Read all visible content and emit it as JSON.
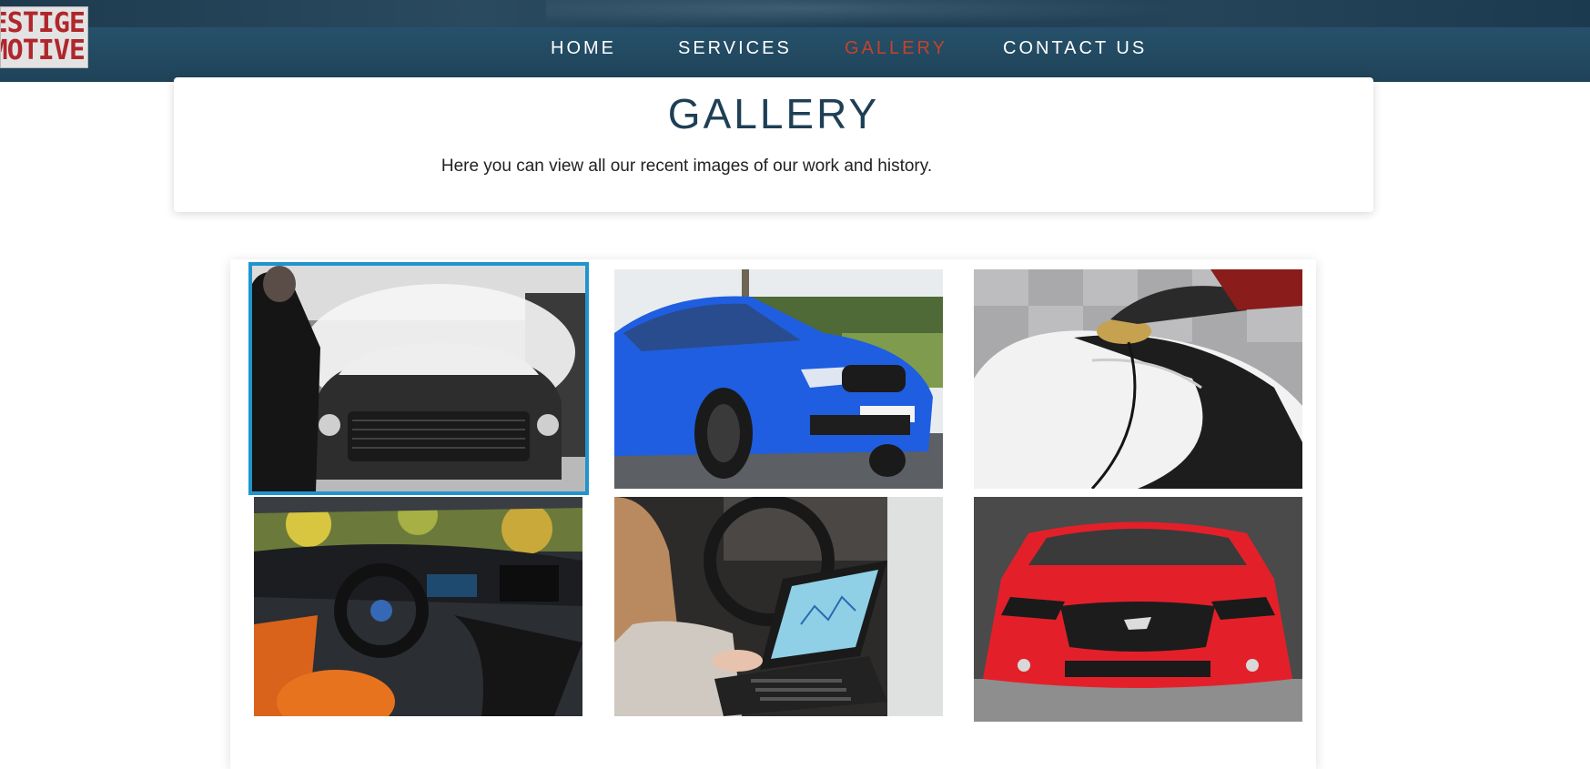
{
  "logo": {
    "line1": "ESTIGE",
    "line2": "MOTIVE"
  },
  "nav": {
    "items": [
      {
        "label": "HOME",
        "active": false
      },
      {
        "label": "SERVICES",
        "active": false
      },
      {
        "label": "GALLERY",
        "active": true
      },
      {
        "label": "CONTACT US",
        "active": false
      }
    ]
  },
  "intro": {
    "title": "GALLERY",
    "subtitle": "Here you can view all our recent images of our work and history."
  },
  "gallery": {
    "selected_index": 0,
    "colors": {
      "selection_outline": "#2194cf",
      "active_nav": "#c8412a",
      "title": "#1e3f55"
    },
    "images": [
      {
        "subject": "snow-foam-car-wash"
      },
      {
        "subject": "blue-bmw-sedan"
      },
      {
        "subject": "machine-polishing-car-panel"
      },
      {
        "subject": "bmw-i8-interior"
      },
      {
        "subject": "laptop-vehicle-diagnostics"
      },
      {
        "subject": "red-ford-mustang-front"
      }
    ]
  }
}
